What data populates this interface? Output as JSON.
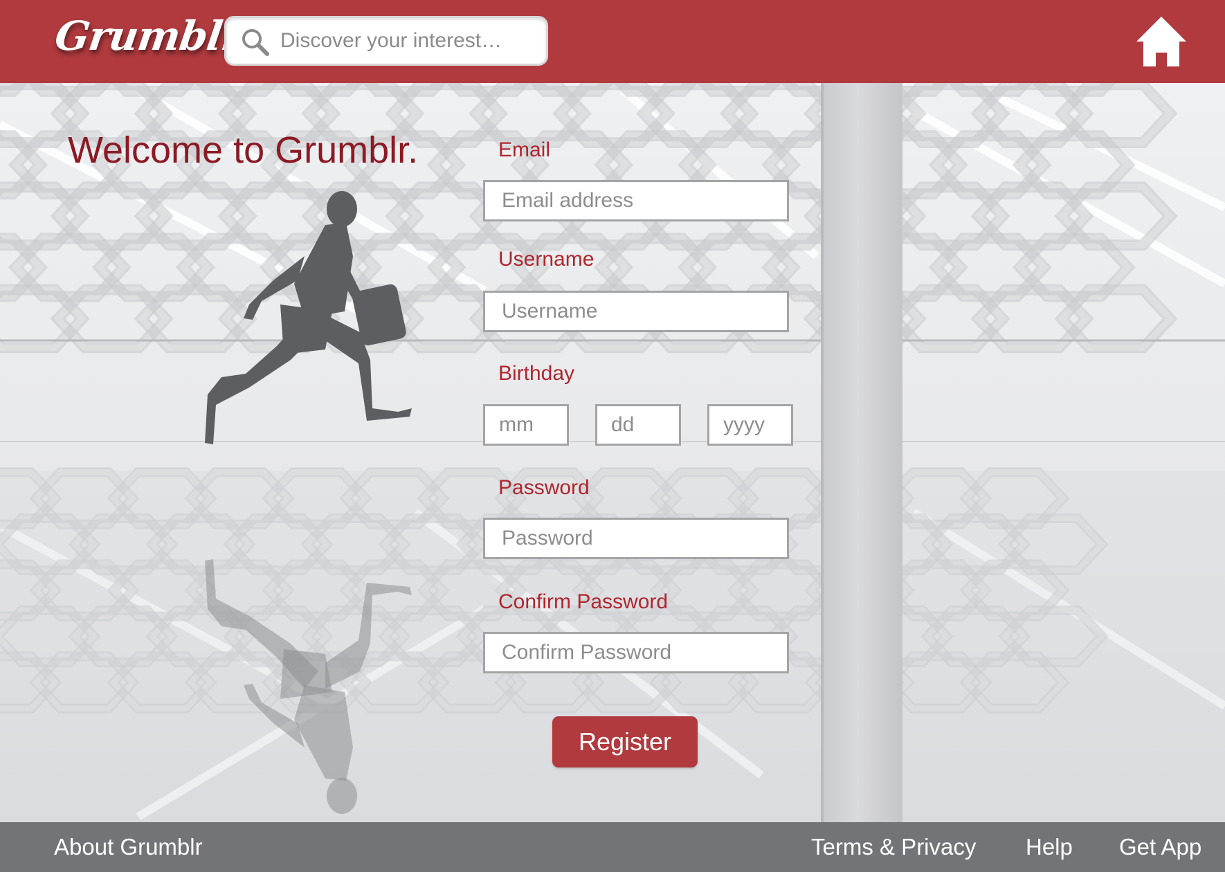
{
  "header": {
    "logo_text": "Grumblr",
    "search": {
      "placeholder": "Discover your interest…"
    },
    "home_icon": "home-icon",
    "search_icon": "search-icon"
  },
  "main": {
    "welcome": "Welcome to Grumblr.",
    "form": {
      "email_label": "Email",
      "email_placeholder": "Email address",
      "username_label": "Username",
      "username_placeholder": "Username",
      "birthday_label": "Birthday",
      "birthday_month_placeholder": "mm",
      "birthday_day_placeholder": "dd",
      "birthday_year_placeholder": "yyyy",
      "password_label": "Password",
      "password_placeholder": "Password",
      "confirm_label": "Confirm Password",
      "confirm_placeholder": "Confirm Password",
      "register_label": "Register"
    }
  },
  "footer": {
    "about": "About Grumblr",
    "terms": "Terms & Privacy",
    "help": "Help",
    "get_app": "Get App"
  },
  "colors": {
    "brand": "#b13a3e",
    "label": "#b0262e",
    "welcome": "#8b1a24",
    "footer": "#69696c"
  }
}
